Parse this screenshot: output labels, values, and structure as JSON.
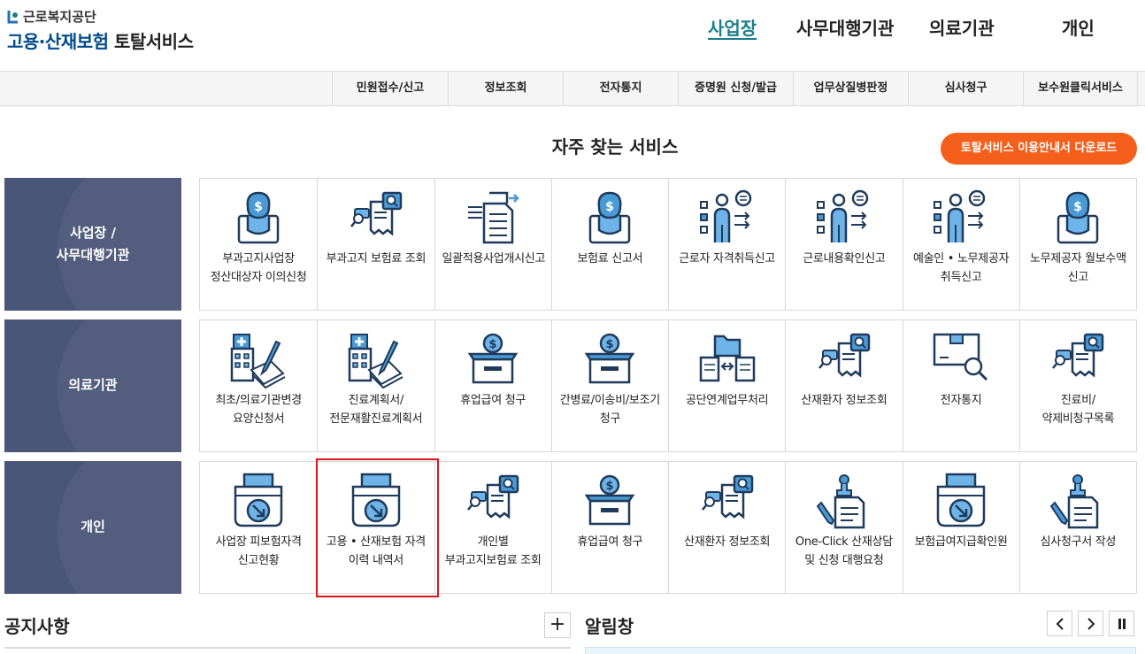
{
  "header": {
    "org_name": "근로복지공단",
    "service_title_main": "고용·산재보험",
    "service_title_sub": "토탈서비스",
    "main_nav": [
      {
        "label": "사업장",
        "active": true
      },
      {
        "label": "사무대행기관",
        "active": false
      },
      {
        "label": "의료기관",
        "active": false
      },
      {
        "label": "개인",
        "active": false
      }
    ]
  },
  "sub_nav": [
    "민원접수/신고",
    "정보조회",
    "전자통지",
    "증명원 신청/발급",
    "업무상질병판정",
    "심사청구",
    "보수원클릭서비스"
  ],
  "section": {
    "title": "자주 찾는 서비스",
    "guide_button": "토탈서비스 이용안내서 다운로드"
  },
  "rows": [
    {
      "category": [
        "사업장 /",
        "사무대행기관"
      ],
      "items": [
        {
          "label": "부과고지사업장 정산대상자 이의신청",
          "icon": "money-bag-icon"
        },
        {
          "label": "부과고지 보험료 조회",
          "icon": "document-search-icon"
        },
        {
          "label": "일괄적용사업개시신고",
          "icon": "document-transfer-icon"
        },
        {
          "label": "보험료 신고서",
          "icon": "money-bag-icon"
        },
        {
          "label": "근로자 자격취득신고",
          "icon": "person-list-icon"
        },
        {
          "label": "근로내용확인신고",
          "icon": "person-list-icon"
        },
        {
          "label": "예술인 • 노무제공자 취득신고",
          "icon": "person-list-icon"
        },
        {
          "label": "노무제공자 월보수액 신고",
          "icon": "money-bag-icon"
        }
      ]
    },
    {
      "category": [
        "의료기관"
      ],
      "items": [
        {
          "label": "최초/의료기관변경 요양신청서",
          "icon": "hospital-pen-icon"
        },
        {
          "label": "진료계획서/전문재활진료계획서",
          "icon": "hospital-pen-icon"
        },
        {
          "label": "휴업급여 청구",
          "icon": "money-box-icon"
        },
        {
          "label": "간병료/이송비/보조기 청구",
          "icon": "money-box-icon"
        },
        {
          "label": "공단연계업무처리",
          "icon": "folder-exchange-icon"
        },
        {
          "label": "산재환자 정보조회",
          "icon": "document-search-icon"
        },
        {
          "label": "전자통지",
          "icon": "package-search-icon"
        },
        {
          "label": "진료비/약제비청구목록",
          "icon": "document-search-icon"
        }
      ]
    },
    {
      "category": [
        "개인"
      ],
      "items": [
        {
          "label": "사업장 피보험자격 신고현황",
          "icon": "printer-arrow-icon"
        },
        {
          "label": "고용 • 산재보험 자격 이력 내역서",
          "icon": "printer-arrow-icon"
        },
        {
          "label": "개인별 부과고지보험료 조회",
          "icon": "document-search-icon"
        },
        {
          "label": "휴업급여 청구",
          "icon": "money-box-icon"
        },
        {
          "label": "산재환자 정보조회",
          "icon": "document-search-icon"
        },
        {
          "label": "One-Click 산재상담 및 신청 대행요청",
          "icon": "stamp-document-icon"
        },
        {
          "label": "보험급여지급확인원",
          "icon": "printer-arrow-icon"
        },
        {
          "label": "심사청구서 작성",
          "icon": "stamp-document-icon"
        }
      ]
    }
  ],
  "notice": {
    "title": "공지사항",
    "more_label": "+"
  },
  "alert": {
    "title": "알림창"
  },
  "colors": {
    "accent_teal": "#1a7f8a",
    "category_bg": "#4a5678",
    "orange_button": "#f4601c",
    "icon_blue": "#2a6fb3",
    "highlight_red": "#e0141e"
  }
}
